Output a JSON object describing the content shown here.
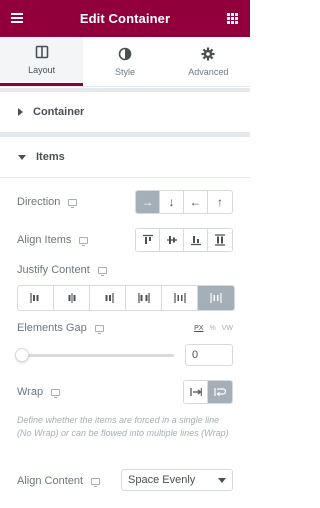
{
  "header": {
    "title": "Edit Container",
    "menu_icon": "hamburger-icon",
    "apps_icon": "grid-icon",
    "bg_color": "#92003b"
  },
  "tabs": [
    {
      "label": "Layout",
      "icon": "layout-icon",
      "active": true
    },
    {
      "label": "Style",
      "icon": "contrast-icon",
      "active": false
    },
    {
      "label": "Advanced",
      "icon": "gear-icon",
      "active": false
    }
  ],
  "sections": {
    "container": {
      "label": "Container"
    },
    "items": {
      "label": "Items"
    }
  },
  "controls": {
    "direction": {
      "label": "Direction",
      "options": [
        "→",
        "↓",
        "←",
        "↑"
      ],
      "selected_index": 0
    },
    "align_items": {
      "label": "Align Items"
    },
    "justify_content": {
      "label": "Justify Content",
      "selected_index": 5
    },
    "elements_gap": {
      "label": "Elements Gap",
      "units": [
        "PX",
        "%",
        "VW"
      ],
      "selected_unit": "PX",
      "value": "0",
      "slider_fraction": 0
    },
    "wrap": {
      "label": "Wrap",
      "selected_index": 1,
      "description": "Define whether the items are forced in a single line (No Wrap) or can be flowed into multiple lines (Wrap)"
    },
    "align_content": {
      "label": "Align Content",
      "value": "Space Evenly"
    }
  }
}
